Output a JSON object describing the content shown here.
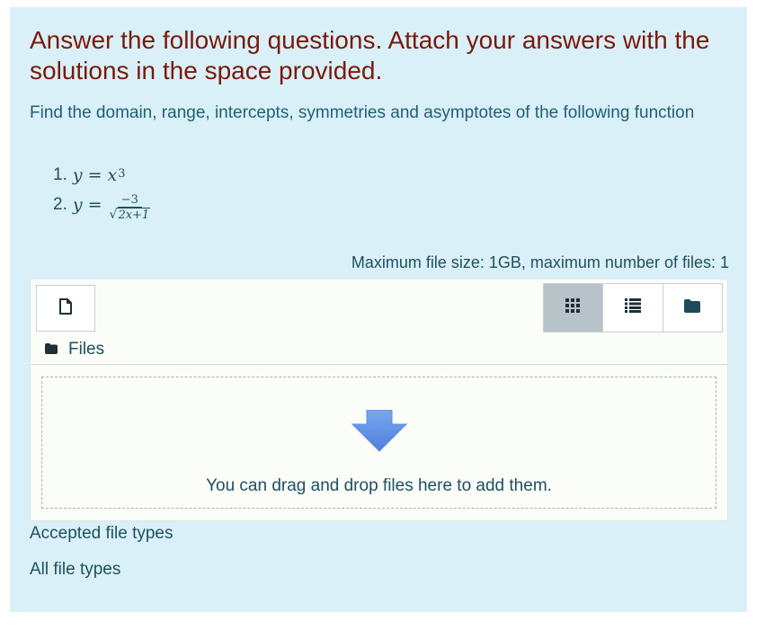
{
  "question": {
    "prompt": "Answer the following questions. Attach your answers with the solutions in the space provided.",
    "instructions": "Find the domain, range, intercepts, symmetries and asymptotes of the following function",
    "items": [
      {
        "number": "1.",
        "lhs": "y",
        "eq": "=",
        "base": "x",
        "exponent": "3"
      },
      {
        "number": "2.",
        "lhs": "y",
        "eq": "=",
        "numerator": "−3",
        "sqrt_sign": "√",
        "radicand": "2x+1"
      }
    ]
  },
  "filepicker": {
    "max_size_text": "Maximum file size: 1GB, maximum number of files: 1",
    "path_label": "Files",
    "drop_text": "You can drag and drop files here to add them.",
    "icons": {
      "add": "file-icon",
      "grid_view": "grid-icon",
      "list_view": "list-icon",
      "tree_view": "folder-icon",
      "path": "folder-icon",
      "drop": "down-arrow-icon"
    },
    "colors": {
      "panel_bg": "#d9f0f8",
      "prompt_text": "#7a1a0a",
      "body_text": "#1f4f5e",
      "active_view_bg": "#b7c3c9",
      "arrow_blue": "#5b8ee6"
    }
  },
  "accepted": {
    "title": "Accepted file types",
    "value": "All file types"
  }
}
